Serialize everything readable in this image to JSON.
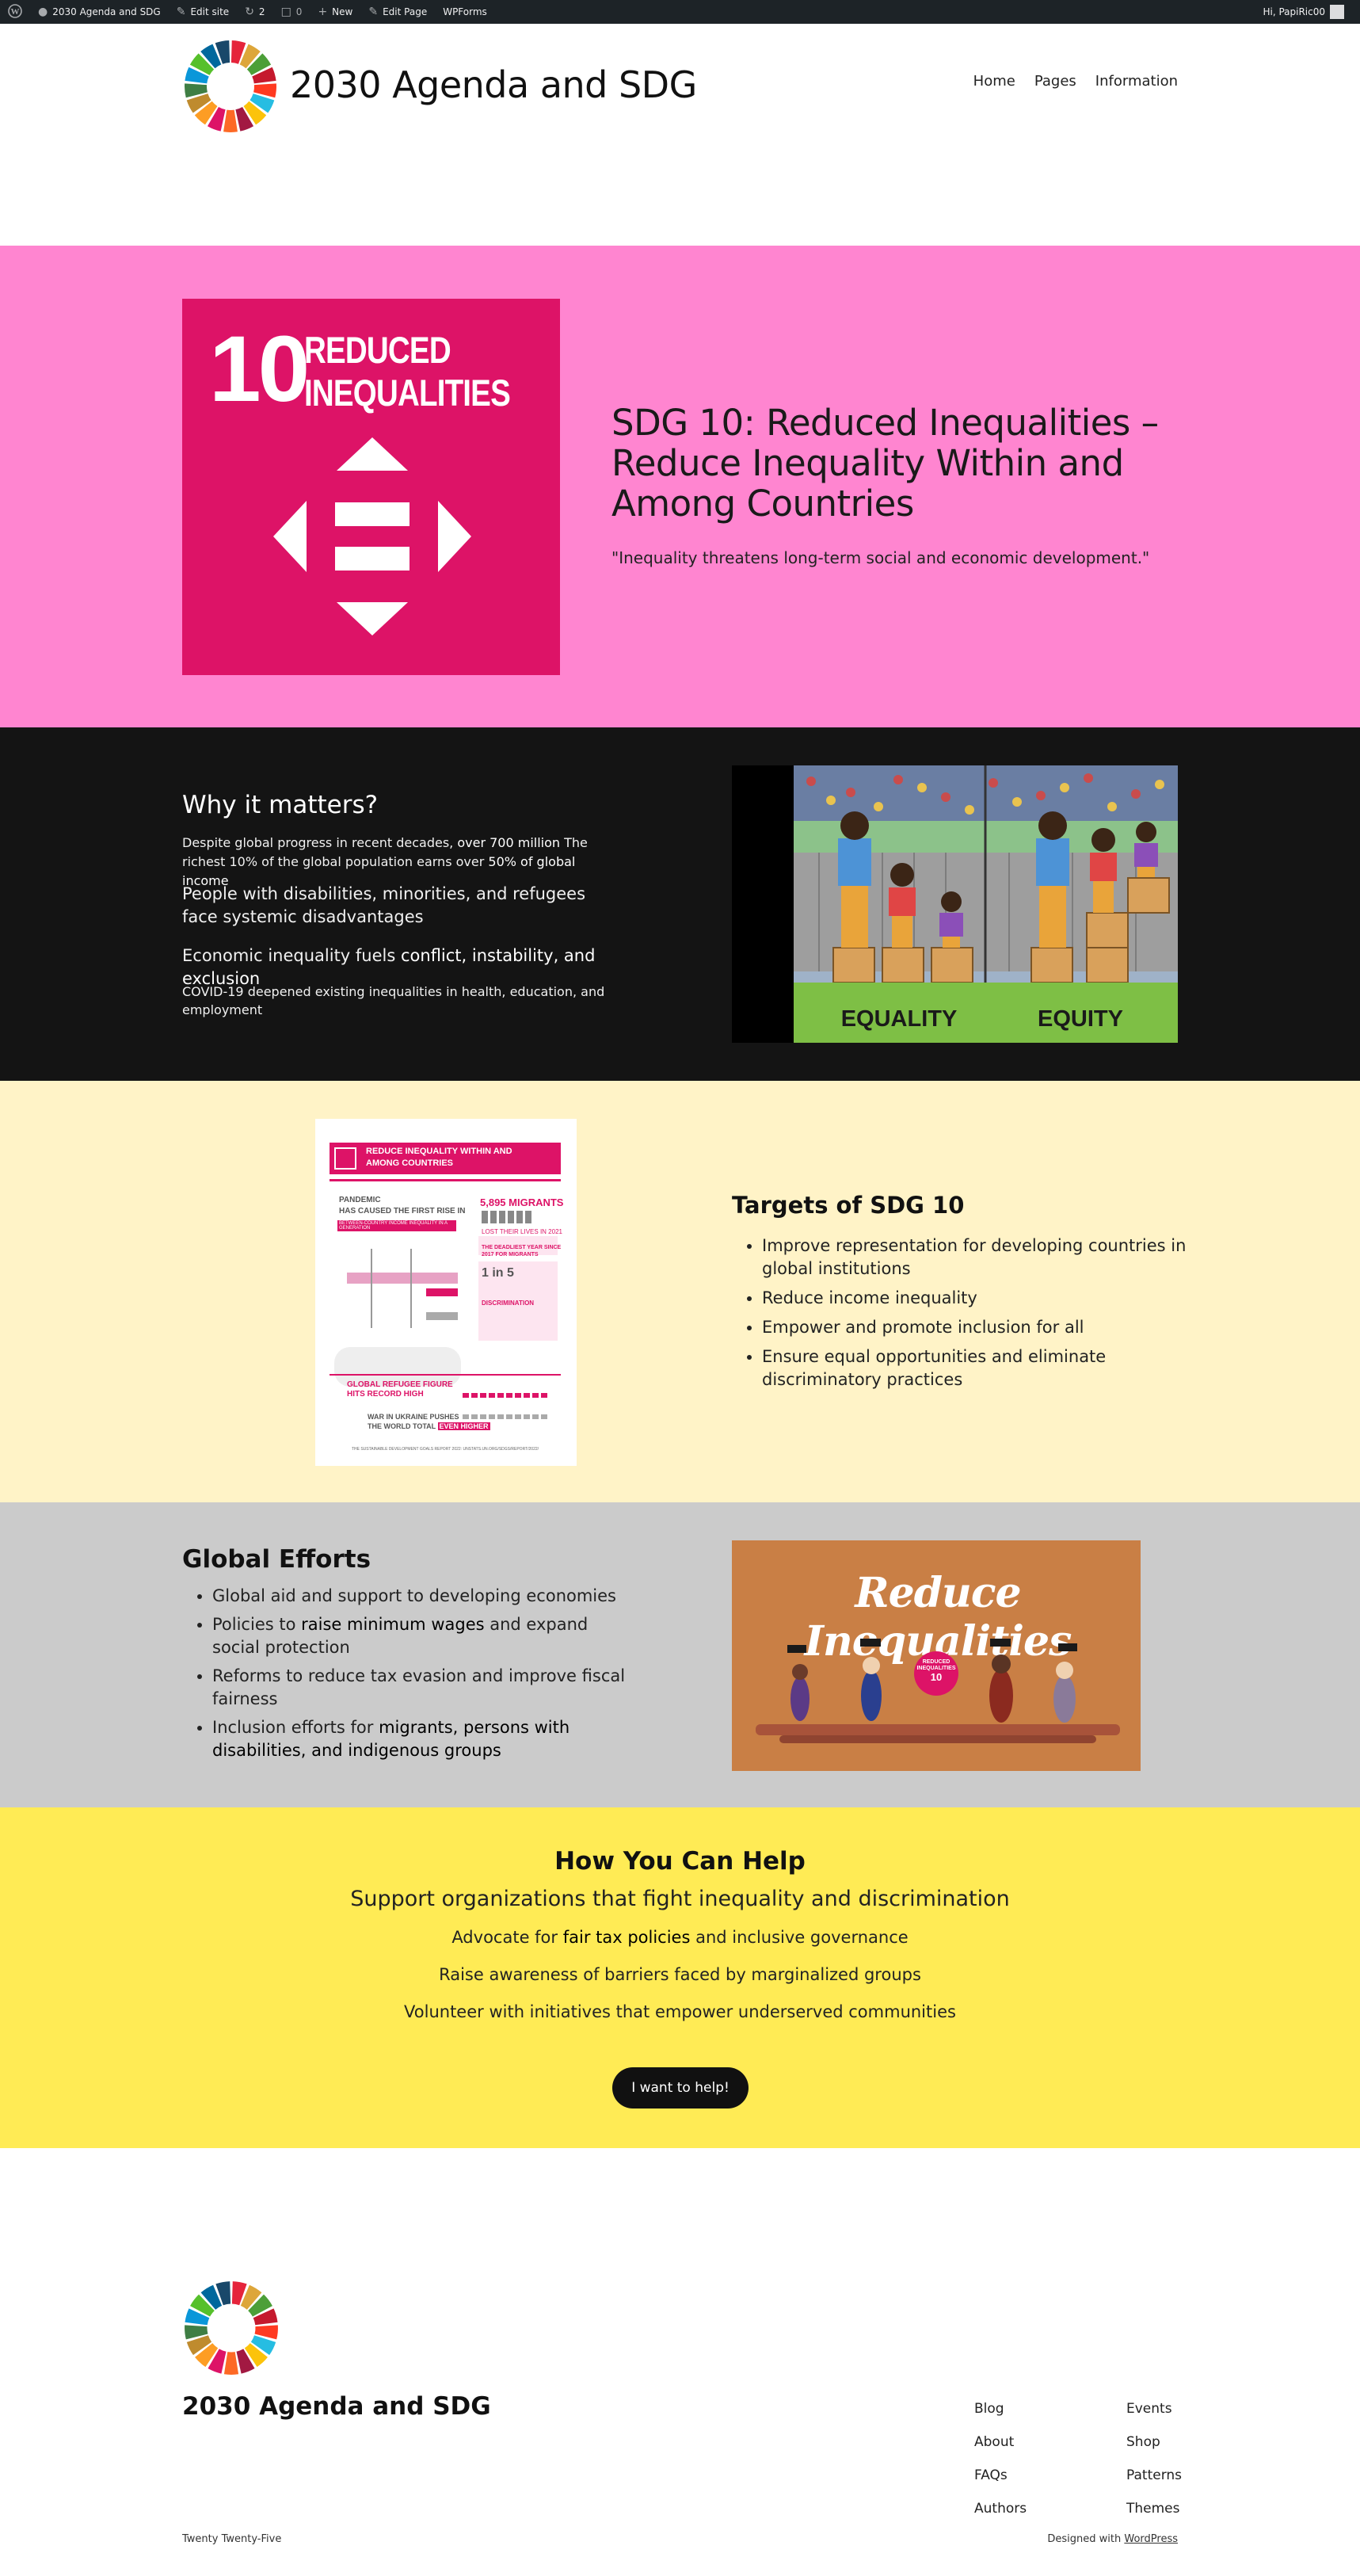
{
  "admin_bar": {
    "site_name": "2030 Agenda and SDG",
    "edit_site": "Edit site",
    "updates_count": "2",
    "comments_count": "0",
    "new_label": "New",
    "edit_page": "Edit Page",
    "wpforms": "WPForms",
    "greeting": "Hi, PapiRic00"
  },
  "header": {
    "site_title": "2030 Agenda and SDG",
    "nav": [
      "Home",
      "Pages",
      "Information"
    ]
  },
  "hero": {
    "tile_number": "10",
    "tile_line1": "REDUCED",
    "tile_line2": "INEQUALITIES",
    "title": "SDG 10: Reduced Inequalities – Reduce Inequality Within and Among Countries",
    "quote": "\"Inequality threatens long-term social and economic development.\"",
    "tile_color": "#dd1367",
    "background": "#ff85d0"
  },
  "why": {
    "heading": "Why it matters?",
    "p1_a": "Despite global progress in recent decades, ",
    "p1_b": "over 700 million",
    "p1_c": " The richest 10% of the global population earns over ",
    "p1_d": "50% of global income",
    "p2": "People with disabilities, minorities, and refugees face systemic disadvantages",
    "p3_a": "Economic inequality fuels ",
    "p3_b": "conflict, instability, and exclusion",
    "p4": "COVID-19 deepened existing inequalities in health, education, and employment",
    "image_label_left": "EQUALITY",
    "image_label_right": "EQUITY"
  },
  "targets": {
    "heading": "Targets of SDG 10",
    "items": [
      "Improve representation for developing countries in global institutions",
      "Reduce income inequality",
      "Empower and promote inclusion for all",
      "Ensure equal opportunities and eliminate discriminatory practices"
    ],
    "infographic": {
      "banner_line1": "REDUCE INEQUALITY WITHIN AND",
      "banner_line2": "AMONG COUNTRIES",
      "pandemic_1": "PANDEMIC",
      "pandemic_2": "HAS CAUSED THE FIRST RISE IN",
      "pandemic_3": "BETWEEN-COUNTRY INCOME INEQUALITY IN A GENERATION",
      "migrants": "5,895 MIGRANTS",
      "migrants_sub": "LOST THEIR LIVES IN 2021",
      "deadliest": "THE DEADLIEST YEAR SINCE",
      "deadliest_2": "2017 FOR MIGRANTS",
      "ratio": "1 in 5",
      "discrimination": "DISCRIMINATION",
      "refugee_1": "GLOBAL REFUGEE FIGURE",
      "refugee_2": "HITS RECORD HIGH",
      "war_1": "WAR IN UKRAINE PUSHES",
      "war_2": "THE WORLD TOTAL",
      "war_3": "EVEN HIGHER",
      "footer": "THE SUSTAINABLE DEVELOPMENT GOALS REPORT 2022: UNSTATS.UN.ORG/SDGS/REPORT/2022/"
    }
  },
  "efforts": {
    "heading": "Global Efforts",
    "item1": "Global aid and support to developing economies",
    "item2_a": "Policies to ",
    "item2_b": "raise minimum wages",
    "item2_c": " and expand social protection",
    "item3": "Reforms to reduce tax evasion and improve fiscal fairness",
    "item4_a": "Inclusion efforts for ",
    "item4_b": "migrants, persons with disabilities, and indigenous groups",
    "image_title": "Reduce Inequalities",
    "badge_1": "REDUCED",
    "badge_2": "INEQUALITIES",
    "badge_num": "10"
  },
  "help": {
    "heading": "How You Can Help",
    "sub": "Support organizations that fight inequality and discrimination",
    "line1_a": "Advocate for ",
    "line1_b": "fair tax policies",
    "line1_c": " and inclusive governance",
    "line2": "Raise awareness of barriers faced by marginalized groups",
    "line3": "Volunteer with initiatives that empower underserved communities",
    "button": "I want to help!"
  },
  "footer": {
    "site_title": "2030 Agenda and SDG",
    "links_col1": [
      "Blog",
      "About",
      "FAQs",
      "Authors"
    ],
    "links_col2": [
      "Events",
      "Shop",
      "Patterns",
      "Themes"
    ],
    "theme_name": "Twenty Twenty-Five",
    "credit_text": "Designed with ",
    "credit_link": "WordPress"
  }
}
